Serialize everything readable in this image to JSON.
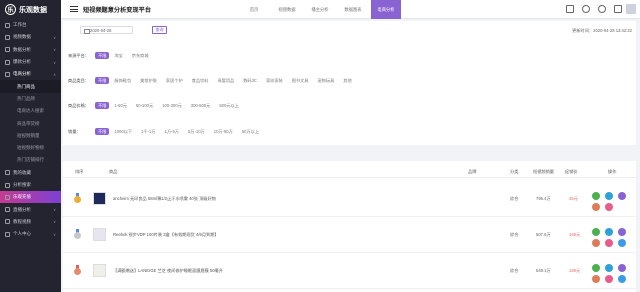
{
  "app": {
    "brand": "乐观数据",
    "logo_glyph": "乐",
    "page_title": "短视频题意分析变现平台"
  },
  "sidebar": {
    "items": [
      {
        "label": "工作台",
        "kind": "top"
      },
      {
        "label": "视频数据",
        "kind": "top",
        "caret": "∨"
      },
      {
        "label": "数据分析",
        "kind": "top",
        "caret": "∨"
      },
      {
        "label": "爆款分析",
        "kind": "top",
        "caret": "∨"
      },
      {
        "label": "电商分析",
        "kind": "open",
        "caret": "∧"
      },
      {
        "label": "热门商品",
        "kind": "sub active"
      },
      {
        "label": "热门品牌",
        "kind": "sub"
      },
      {
        "label": "电商达人搜索",
        "kind": "sub"
      },
      {
        "label": "商品带货榜",
        "kind": "sub"
      },
      {
        "label": "短视频销量",
        "kind": "sub"
      },
      {
        "label": "短视频好物榜",
        "kind": "sub"
      },
      {
        "label": "热门店铺排行",
        "kind": "sub"
      },
      {
        "label": "我的收藏",
        "kind": "top"
      },
      {
        "label": "分析搜索",
        "kind": "top"
      },
      {
        "label": "乐观充值",
        "kind": "hl"
      },
      {
        "label": "直播分析",
        "kind": "top",
        "caret": "∨"
      },
      {
        "label": "教程视频",
        "kind": "top",
        "caret": "∨"
      },
      {
        "label": "个人中心",
        "kind": "top",
        "caret": "∨"
      }
    ]
  },
  "topbar": {
    "tabs": [
      {
        "label": "首页",
        "active": false
      },
      {
        "label": "视频数据",
        "active": false
      },
      {
        "label": "播主分析",
        "active": false
      },
      {
        "label": "数据图表",
        "active": false
      },
      {
        "label": "电商分析",
        "active": true
      }
    ],
    "icons": [
      "grid-icon",
      "chat-icon",
      "bell-icon",
      "fullscreen-icon"
    ]
  },
  "filters": {
    "date_value": "2020-04-28",
    "query_label": "查询",
    "updated_text": "更新时间：2020-04-28 13:42:22",
    "rows": [
      {
        "label": "来源平台：",
        "options": [
          "不限",
          "淘宝",
          "京东商城"
        ]
      },
      {
        "label": "商品类目：",
        "options": [
          "不限",
          "服饰鞋包",
          "美妆护肤",
          "家居个护",
          "食品饮料",
          "母婴用品",
          "数码3C",
          "家纺家装",
          "图书文具",
          "宠物玩具",
          "其他"
        ]
      },
      {
        "label": "商品价格：",
        "options": [
          "不限",
          "1-50元",
          "50-100元",
          "100-300元",
          "300-500元",
          "500元以上"
        ]
      },
      {
        "label": "销量：",
        "options": [
          "不限",
          "1000以下",
          "1千-1万",
          "1万-5万",
          "5万-10万",
          "10万-50万",
          "50万以上"
        ]
      }
    ]
  },
  "table": {
    "headers": {
      "rank": "排序",
      "product": "商品",
      "brand": "品牌",
      "category": "分类",
      "sales": "短视频销量",
      "price": "促销价",
      "ops": "操作"
    },
    "rows": [
      {
        "name": "ancheim 无印良品 58ml薄1/2止汗水喷雾 40张 顶级好物",
        "category": "综合",
        "sales": "796.4万",
        "price": "35元",
        "medal_color": "#e8b03a",
        "ribbon": "#5a8ad4"
      },
      {
        "name": "Reebok 锐步VDP 100片装 3盒【有效期现货 4/6月到期】",
        "category": "综合",
        "sales": "507.6万",
        "price": "169元",
        "medal_color": "#c7c7cf",
        "ribbon": "#5a8ad4"
      },
      {
        "name": "【满额赠送】LANEIGE 兰芝 夜间修护睡眠面膜唇膜 50毫升",
        "category": "综合",
        "sales": "549.1万",
        "price": "189元",
        "medal_color": "#e28c6e",
        "ribbon": "#e06060"
      }
    ],
    "action_colors": [
      "#4caf50",
      "#2ca3d8",
      "#8a63d2",
      "#e07b5a",
      "#e65c8a",
      "#3c9be8"
    ]
  }
}
